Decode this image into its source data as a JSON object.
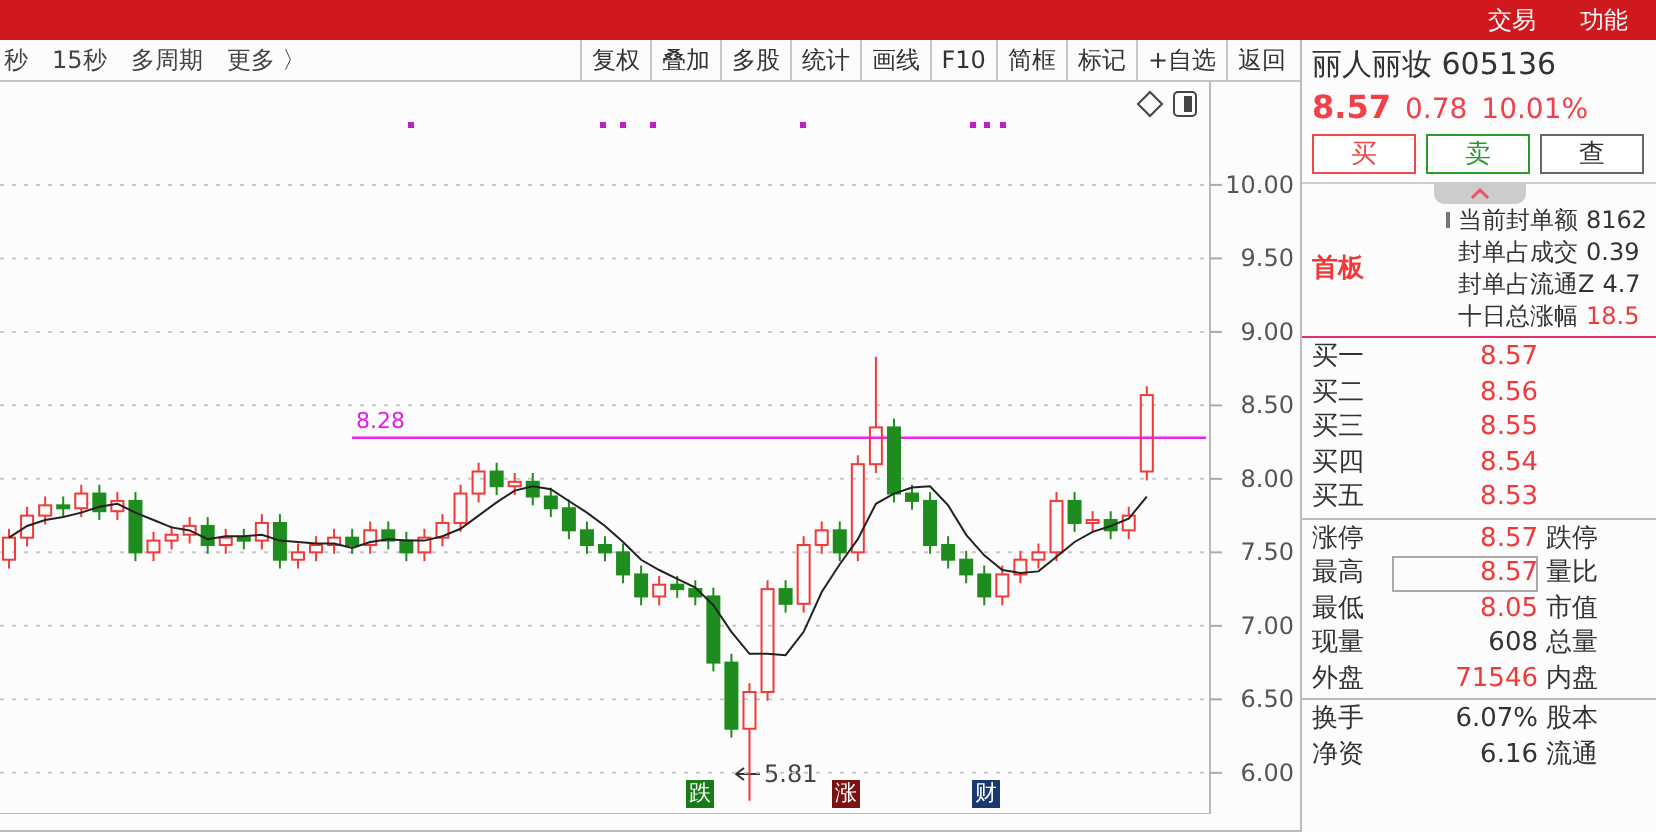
{
  "top_bar": {
    "menu": [
      "交易",
      "功能"
    ]
  },
  "period_bar": {
    "items": [
      "秒",
      "15秒",
      "多周期",
      "更多 〉"
    ]
  },
  "toolbar": {
    "buttons": [
      "复权",
      "叠加",
      "多股",
      "统计",
      "画线",
      "F10",
      "简框",
      "标记",
      "+自选",
      "返回"
    ]
  },
  "chart": {
    "reference_label": "8.28",
    "low_label": "5.81",
    "chart_data": {
      "type": "candlestick",
      "ylim": [
        5.72,
        10.7
      ],
      "grid": true,
      "ohlc": [
        [
          7.45,
          7.66,
          7.39,
          7.6
        ],
        [
          7.6,
          7.81,
          7.54,
          7.75
        ],
        [
          7.75,
          7.88,
          7.69,
          7.82
        ],
        [
          7.82,
          7.88,
          7.74,
          7.8
        ],
        [
          7.8,
          7.96,
          7.74,
          7.9
        ],
        [
          7.9,
          7.96,
          7.72,
          7.78
        ],
        [
          7.78,
          7.91,
          7.72,
          7.85
        ],
        [
          7.85,
          7.91,
          7.44,
          7.5
        ],
        [
          7.5,
          7.64,
          7.44,
          7.58
        ],
        [
          7.58,
          7.68,
          7.52,
          7.62
        ],
        [
          7.62,
          7.74,
          7.56,
          7.68
        ],
        [
          7.68,
          7.74,
          7.49,
          7.55
        ],
        [
          7.55,
          7.66,
          7.49,
          7.6
        ],
        [
          7.6,
          7.66,
          7.52,
          7.58
        ],
        [
          7.58,
          7.76,
          7.52,
          7.7
        ],
        [
          7.7,
          7.76,
          7.39,
          7.45
        ],
        [
          7.45,
          7.56,
          7.39,
          7.5
        ],
        [
          7.5,
          7.61,
          7.44,
          7.55
        ],
        [
          7.55,
          7.66,
          7.49,
          7.6
        ],
        [
          7.6,
          7.66,
          7.49,
          7.55
        ],
        [
          7.55,
          7.71,
          7.49,
          7.65
        ],
        [
          7.65,
          7.71,
          7.52,
          7.58
        ],
        [
          7.58,
          7.64,
          7.44,
          7.5
        ],
        [
          7.5,
          7.66,
          7.44,
          7.6
        ],
        [
          7.6,
          7.76,
          7.54,
          7.7
        ],
        [
          7.7,
          7.96,
          7.64,
          7.9
        ],
        [
          7.9,
          8.11,
          7.84,
          8.05
        ],
        [
          8.05,
          8.11,
          7.89,
          7.95
        ],
        [
          7.95,
          8.04,
          7.89,
          7.98
        ],
        [
          7.98,
          8.04,
          7.82,
          7.88
        ],
        [
          7.88,
          7.94,
          7.74,
          7.8
        ],
        [
          7.8,
          7.86,
          7.59,
          7.65
        ],
        [
          7.65,
          7.71,
          7.49,
          7.55
        ],
        [
          7.55,
          7.61,
          7.44,
          7.5
        ],
        [
          7.5,
          7.56,
          7.29,
          7.35
        ],
        [
          7.35,
          7.41,
          7.14,
          7.2
        ],
        [
          7.2,
          7.34,
          7.14,
          7.28
        ],
        [
          7.28,
          7.34,
          7.19,
          7.25
        ],
        [
          7.25,
          7.31,
          7.14,
          7.2
        ],
        [
          7.2,
          7.26,
          6.69,
          6.75
        ],
        [
          6.75,
          6.81,
          6.24,
          6.3
        ],
        [
          6.3,
          6.61,
          5.81,
          6.55
        ],
        [
          6.55,
          7.31,
          6.49,
          7.25
        ],
        [
          7.25,
          7.31,
          7.09,
          7.15
        ],
        [
          7.15,
          7.61,
          7.09,
          7.55
        ],
        [
          7.55,
          7.71,
          7.49,
          7.65
        ],
        [
          7.65,
          7.71,
          7.44,
          7.5
        ],
        [
          7.5,
          8.16,
          7.44,
          8.1
        ],
        [
          8.1,
          8.83,
          8.04,
          8.35
        ],
        [
          8.35,
          8.41,
          7.84,
          7.9
        ],
        [
          7.9,
          7.96,
          7.79,
          7.85
        ],
        [
          7.85,
          7.91,
          7.49,
          7.55
        ],
        [
          7.55,
          7.61,
          7.39,
          7.45
        ],
        [
          7.45,
          7.51,
          7.29,
          7.35
        ],
        [
          7.35,
          7.41,
          7.14,
          7.2
        ],
        [
          7.2,
          7.41,
          7.14,
          7.35
        ],
        [
          7.35,
          7.51,
          7.29,
          7.45
        ],
        [
          7.45,
          7.56,
          7.39,
          7.5
        ],
        [
          7.5,
          7.91,
          7.44,
          7.85
        ],
        [
          7.85,
          7.91,
          7.64,
          7.7
        ],
        [
          7.7,
          7.78,
          7.64,
          7.72
        ],
        [
          7.72,
          7.78,
          7.59,
          7.65
        ],
        [
          7.65,
          7.81,
          7.59,
          7.75
        ],
        [
          8.05,
          8.63,
          7.99,
          8.57
        ],
        null,
        null,
        null
      ],
      "yticks": [
        {
          "value": 10,
          "label": "10.00"
        },
        {
          "value": 9.5,
          "label": "9.50"
        },
        {
          "value": 9,
          "label": "9.00"
        },
        {
          "value": 8.5,
          "label": "8.50"
        },
        {
          "value": 8,
          "label": "8.00"
        },
        {
          "value": 7.5,
          "label": "7.50"
        },
        {
          "value": 7,
          "label": "7.00"
        },
        {
          "value": 6.5,
          "label": "6.50"
        },
        {
          "value": 6,
          "label": "6.00"
        }
      ],
      "series": [
        {
          "type": "line",
          "color": "#222222",
          "values": [
            7.6,
            7.68,
            7.72,
            7.74,
            7.77,
            7.81,
            7.83,
            7.77,
            7.72,
            7.67,
            7.65,
            7.59,
            7.61,
            7.61,
            7.62,
            7.58,
            7.57,
            7.56,
            7.56,
            7.53,
            7.57,
            7.59,
            7.58,
            7.58,
            7.61,
            7.66,
            7.75,
            7.84,
            7.92,
            7.95,
            7.93,
            7.85,
            7.77,
            7.68,
            7.57,
            7.45,
            7.38,
            7.32,
            7.26,
            7.14,
            6.96,
            6.81,
            6.81,
            6.8,
            6.96,
            7.23,
            7.42,
            7.59,
            7.83,
            7.9,
            7.94,
            7.95,
            7.82,
            7.62,
            7.48,
            7.38,
            7.36,
            7.37,
            7.47,
            7.57,
            7.64,
            7.68,
            7.73,
            7.88,
            null,
            null,
            null
          ]
        }
      ]
    },
    "event_markers": [
      {
        "text": "跌",
        "color": "#1a7a1a"
      },
      {
        "text": "涨",
        "color": "#7a1414"
      },
      {
        "text": "财",
        "color": "#1b3a6b"
      }
    ]
  },
  "quote": {
    "name": "丽人丽妆",
    "code": "605136",
    "price": "8.57",
    "change": "0.78",
    "change_pct": "10.01%"
  },
  "trade_buttons": [
    {
      "label": "买",
      "kind": "buy"
    },
    {
      "label": "卖",
      "kind": "sell"
    },
    {
      "label": "查",
      "kind": "query"
    }
  ],
  "board": {
    "tag": "首板",
    "rows": [
      {
        "label": "当前封单额",
        "value": "8162",
        "color": "#333333"
      },
      {
        "label": "封单占成交",
        "value": "0.39",
        "color": "#333333"
      },
      {
        "label": "封单占流通Z",
        "value": "4.7",
        "color": "#333333"
      },
      {
        "label": "十日总涨幅",
        "value": "18.5",
        "color": "#f03a3a"
      }
    ]
  },
  "order_book": [
    {
      "label": "买一",
      "price": "8.57"
    },
    {
      "label": "买二",
      "price": "8.56"
    },
    {
      "label": "买三",
      "price": "8.55"
    },
    {
      "label": "买四",
      "price": "8.54"
    },
    {
      "label": "买五",
      "price": "8.53"
    }
  ],
  "stats": [
    {
      "label": "涨停",
      "value": "8.57",
      "color": "#f03a3a",
      "highlighted": false,
      "label2": "跌停"
    },
    {
      "label": "最高",
      "value": "8.57",
      "color": "#f03a3a",
      "highlighted": true,
      "label2": "量比"
    },
    {
      "label": "最低",
      "value": "8.05",
      "color": "#f03a3a",
      "highlighted": false,
      "label2": "市值"
    },
    {
      "label": "现量",
      "value": "608",
      "color": "#333333",
      "highlighted": false,
      "label2": "总量"
    },
    {
      "label": "外盘",
      "value": "71546",
      "color": "#f03a3a",
      "highlighted": false,
      "label2": "内盘"
    }
  ],
  "stats2": [
    {
      "label": "换手",
      "value": "6.07%",
      "color": "#333333",
      "label2": "股本"
    },
    {
      "label": "净资",
      "value": "6.16",
      "color": "#333333",
      "label2": "流通"
    }
  ]
}
